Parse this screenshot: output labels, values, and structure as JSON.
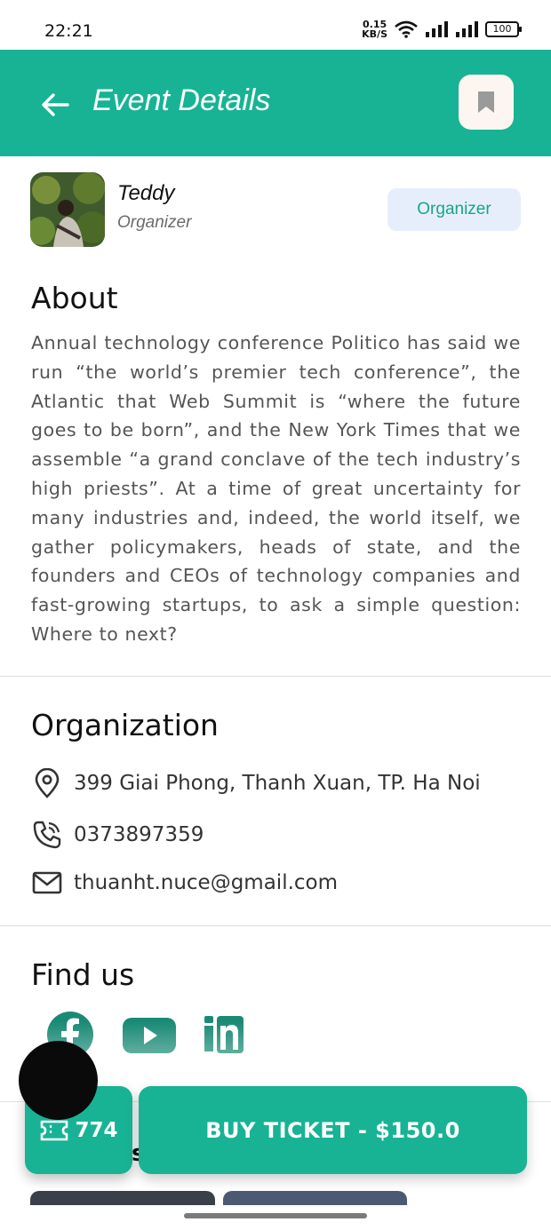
{
  "status_bar": {
    "time": "22:21",
    "net_speed_value": "0.15",
    "net_speed_unit": "KB/S",
    "battery": "100"
  },
  "header": {
    "title": "Event Details",
    "back_icon": "arrow-left-icon",
    "bookmark_icon": "bookmark-icon"
  },
  "organizer": {
    "name": "Teddy",
    "role": "Organizer",
    "badge": "Organizer"
  },
  "about": {
    "title": "About",
    "text": "Annual technology conference Politico has said we run “the world’s premier tech conference”, the Atlantic that Web Summit is “where the future goes to be born”, and the New York Times that we assemble “a grand conclave of the tech industry’s high priests”. At a time of great uncertainty for many industries and, indeed, the world itself, we gather policymakers, heads of state, and the founders and CEOs of technology companies and fast-growing startups, to ask a simple question: Where to next?"
  },
  "organization": {
    "title": "Organization",
    "address": "399 Giai Phong, Thanh Xuan, TP. Ha Noi",
    "phone": "0373897359",
    "email": "thuanht.nuce@gmail.com"
  },
  "find_us": {
    "title": "Find us",
    "links": [
      "facebook-icon",
      "youtube-icon",
      "linkedin-icon"
    ]
  },
  "actions": {
    "ticket_count": "774",
    "buy_label": "BUY TICKET - $150.0"
  },
  "colors": {
    "primary": "#17b394",
    "badge_bg": "#e7eefb",
    "bookmark_bg": "#fdf5ef"
  }
}
